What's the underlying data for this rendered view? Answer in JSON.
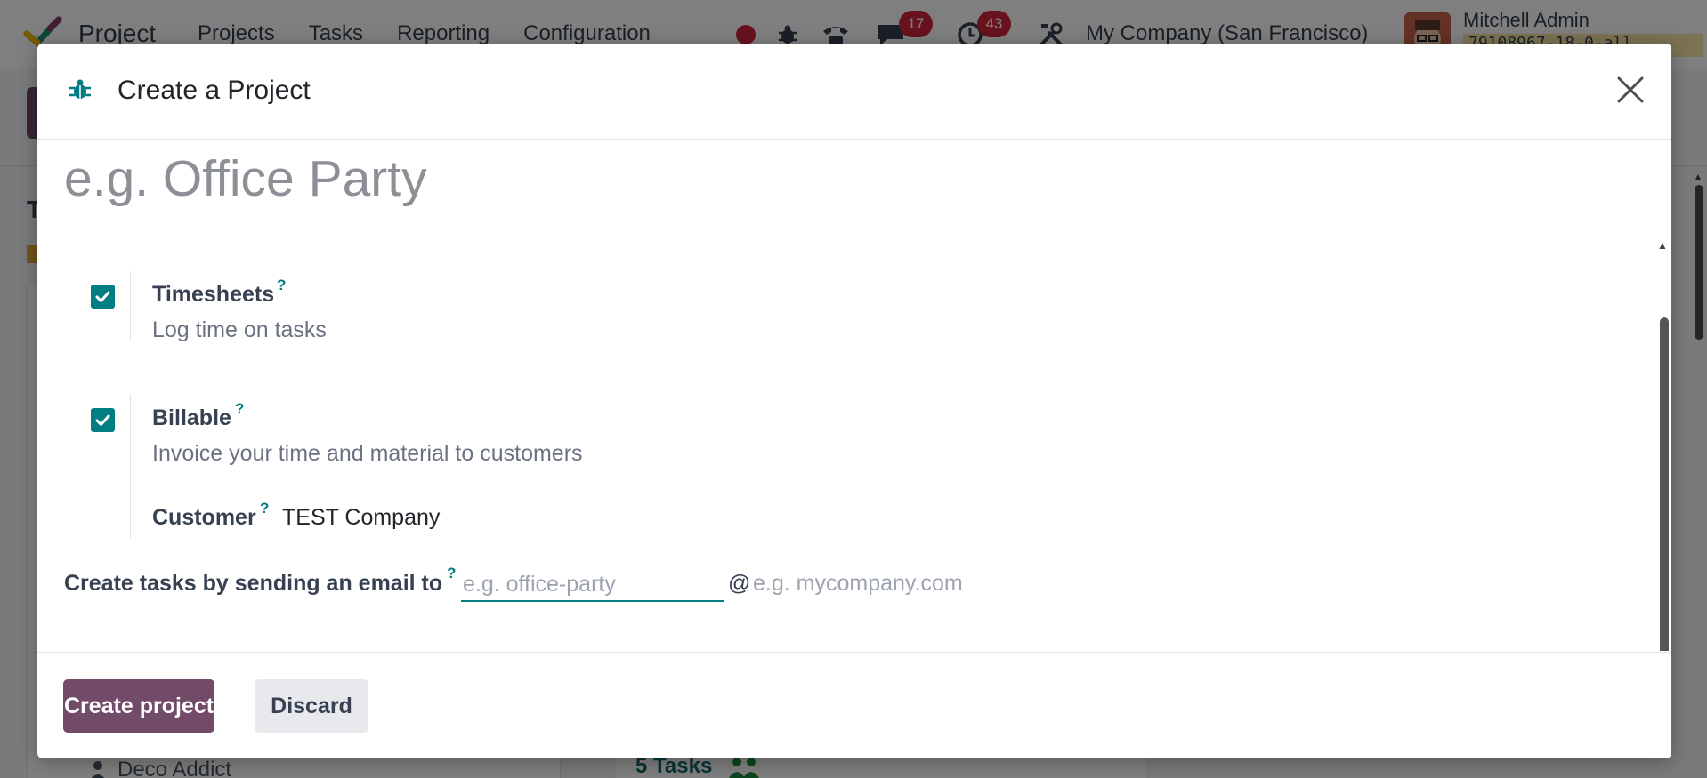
{
  "app": {
    "name": "Project",
    "menu": [
      "Projects",
      "Tasks",
      "Reporting",
      "Configuration"
    ],
    "messages_count": "17",
    "activities_count": "43",
    "company": "My Company (San Francisco)",
    "user_name": "Mitchell Admin",
    "user_db": "79108967-18-0-all"
  },
  "background": {
    "customer": "Deco Addict",
    "tasks": "5 Tasks"
  },
  "modal": {
    "title": "Create a Project",
    "name_placeholder": "e.g. Office Party",
    "options": {
      "timesheets": {
        "label": "Timesheets",
        "help": "?",
        "description": "Log time on tasks",
        "checked": true
      },
      "billable": {
        "label": "Billable",
        "help": "?",
        "description": "Invoice your time and material to customers",
        "checked": true
      },
      "customer": {
        "label": "Customer",
        "help": "?",
        "value": "TEST Company"
      }
    },
    "email": {
      "label": "Create tasks by sending an email to",
      "help": "?",
      "alias_placeholder": "e.g. office-party",
      "at": "@",
      "domain_placeholder": "e.g. mycompany.com"
    },
    "buttons": {
      "create": "Create project",
      "discard": "Discard"
    }
  },
  "colors": {
    "brand": "#714b67",
    "accent": "#017e84",
    "badge": "#d0243a"
  }
}
